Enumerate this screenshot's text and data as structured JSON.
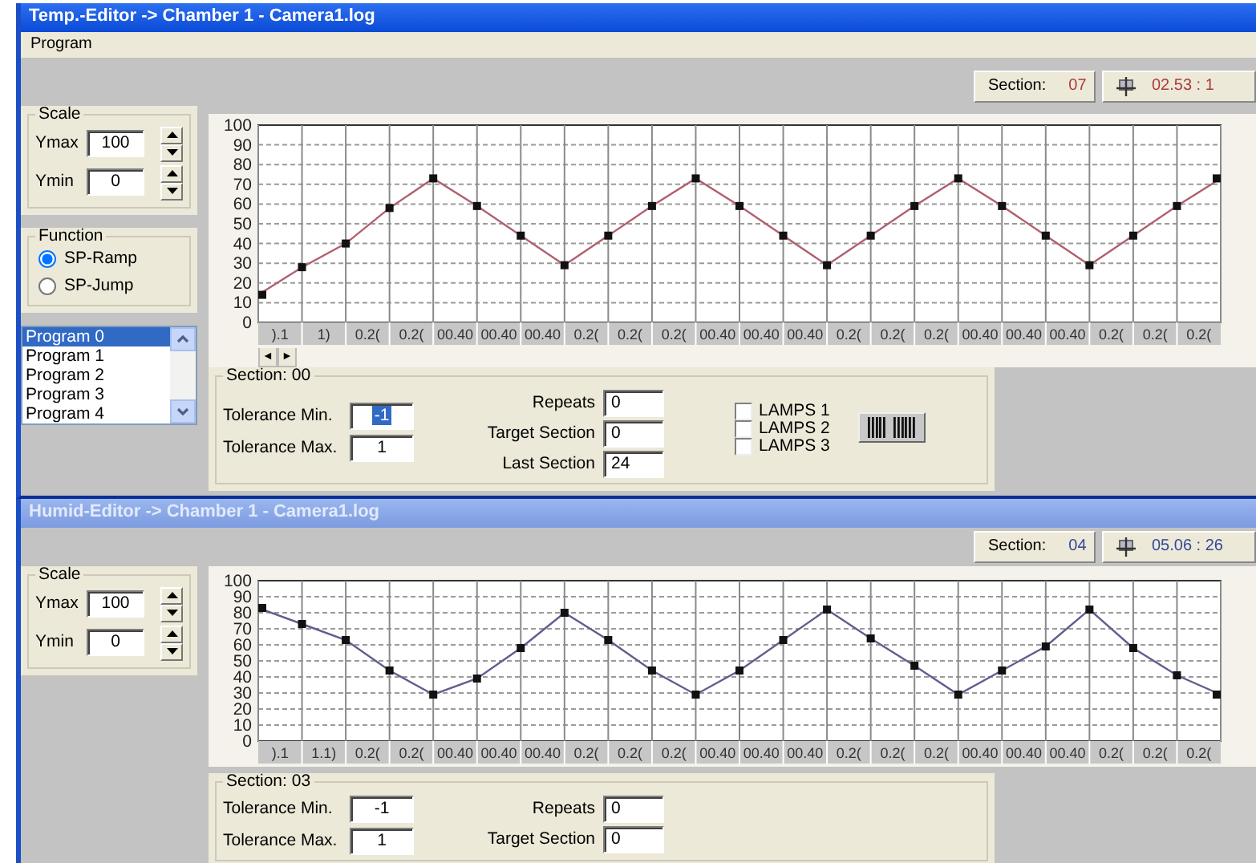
{
  "windows": [
    {
      "title": "Temp.-Editor -> Chamber 1 - Camera1.log",
      "active": true,
      "menu": [
        "Program"
      ],
      "status": {
        "section_label": "Section:",
        "section_value": "07",
        "time": "02.53 : 1",
        "color": "#b03a3a"
      },
      "scale": {
        "title": "Scale",
        "fields": [
          {
            "label": "Ymax",
            "value": "100"
          },
          {
            "label": "Ymin",
            "value": "0"
          }
        ]
      },
      "function": {
        "title": "Function",
        "options": [
          {
            "label": "SP-Ramp",
            "selected": true
          },
          {
            "label": "SP-Jump",
            "selected": false
          }
        ]
      },
      "programs": [
        {
          "label": "Program 0",
          "selected": true
        },
        {
          "label": "Program 1",
          "selected": false
        },
        {
          "label": "Program 2",
          "selected": false
        },
        {
          "label": "Program 3",
          "selected": false
        },
        {
          "label": "Program 4",
          "selected": false
        }
      ],
      "segments": [
        {
          "label": ").1"
        },
        {
          "label": "1)"
        },
        {
          "label": "0.2("
        },
        {
          "label": "0.2("
        },
        {
          "label": "00.40"
        },
        {
          "label": "00.40"
        },
        {
          "label": "00.40"
        },
        {
          "label": "0.2("
        },
        {
          "label": "0.2("
        },
        {
          "label": "0.2("
        },
        {
          "label": "00.40"
        },
        {
          "label": "00.40"
        },
        {
          "label": "00.40"
        },
        {
          "label": "0.2("
        },
        {
          "label": "0.2("
        },
        {
          "label": "0.2("
        },
        {
          "label": "00.40"
        },
        {
          "label": "00.40"
        },
        {
          "label": "00.40"
        },
        {
          "label": "0.2("
        },
        {
          "label": "0.2("
        },
        {
          "label": "0.2("
        }
      ],
      "chart_data": {
        "type": "line",
        "grid": true,
        "ylim": [
          0,
          100
        ],
        "yticks": [
          0,
          10,
          20,
          30,
          40,
          50,
          60,
          70,
          80,
          90,
          100
        ],
        "categories": [
          null,
          null,
          null,
          null,
          null,
          null,
          null,
          null,
          null,
          null,
          null,
          null,
          null,
          null,
          null,
          null,
          null,
          null,
          null,
          null,
          null,
          null,
          null
        ],
        "series": [
          {
            "color": "#b0606e",
            "marker": "square",
            "values": [
              14,
              28,
              40,
              58,
              73,
              59,
              44,
              29,
              44,
              59,
              73,
              59,
              44,
              29,
              44,
              59,
              73,
              59,
              44,
              29,
              44,
              59,
              73
            ]
          }
        ]
      },
      "nav": [
        "◄",
        "►"
      ],
      "section": {
        "title": "Section: 00",
        "tolerances": [
          {
            "label": "Tolerance Min.",
            "value": "-1",
            "selected": true
          },
          {
            "label": "Tolerance Max.",
            "value": "1",
            "selected": false
          }
        ],
        "counters": [
          {
            "label": "Repeats",
            "value": "0"
          },
          {
            "label": "Target Section",
            "value": "0"
          },
          {
            "label": "Last Section",
            "value": "24"
          }
        ],
        "lamps": [
          {
            "label": "LAMPS 1",
            "checked": false
          },
          {
            "label": "LAMPS 2",
            "checked": false
          },
          {
            "label": "LAMPS 3",
            "checked": false
          }
        ],
        "barcode": true
      }
    },
    {
      "title": "Humid-Editor -> Chamber 1 - Camera1.log",
      "active": false,
      "status": {
        "section_label": "Section:",
        "section_value": "04",
        "time": "05.06 : 26",
        "color": "#34479a"
      },
      "scale": {
        "title": "Scale",
        "fields": [
          {
            "label": "Ymax",
            "value": "100"
          },
          {
            "label": "Ymin",
            "value": "0"
          }
        ]
      },
      "segments": [
        {
          "label": ").1"
        },
        {
          "label": "1.1)"
        },
        {
          "label": "0.2("
        },
        {
          "label": "0.2("
        },
        {
          "label": "00.40"
        },
        {
          "label": "00.40"
        },
        {
          "label": "00.40"
        },
        {
          "label": "0.2("
        },
        {
          "label": "0.2("
        },
        {
          "label": "0.2("
        },
        {
          "label": "00.40"
        },
        {
          "label": "00.40"
        },
        {
          "label": "00.40"
        },
        {
          "label": "0.2("
        },
        {
          "label": "0.2("
        },
        {
          "label": "0.2("
        },
        {
          "label": "00.40"
        },
        {
          "label": "00.40"
        },
        {
          "label": "00.40"
        },
        {
          "label": "0.2("
        },
        {
          "label": "0.2("
        },
        {
          "label": "0.2("
        }
      ],
      "chart_data": {
        "type": "line",
        "grid": true,
        "ylim": [
          0,
          100
        ],
        "yticks": [
          0,
          10,
          20,
          30,
          40,
          50,
          60,
          70,
          80,
          90,
          100
        ],
        "categories": [
          null,
          null,
          null,
          null,
          null,
          null,
          null,
          null,
          null,
          null,
          null,
          null,
          null,
          null,
          null,
          null,
          null,
          null,
          null,
          null,
          null,
          null,
          null
        ],
        "series": [
          {
            "color": "#5e5e8e",
            "marker": "square",
            "values": [
              83,
              73,
              63,
              44,
              29,
              39,
              58,
              80,
              63,
              44,
              29,
              44,
              63,
              82,
              64,
              47,
              29,
              44,
              59,
              82,
              58,
              41,
              29
            ]
          }
        ]
      },
      "section": {
        "title": "Section: 03",
        "tolerances": [
          {
            "label": "Tolerance Min.",
            "value": "-1",
            "selected": false
          },
          {
            "label": "Tolerance Max.",
            "value": "1",
            "selected": false
          }
        ],
        "counters": [
          {
            "label": "Repeats",
            "value": "0"
          },
          {
            "label": "Target Section",
            "value": "0"
          }
        ]
      }
    }
  ]
}
